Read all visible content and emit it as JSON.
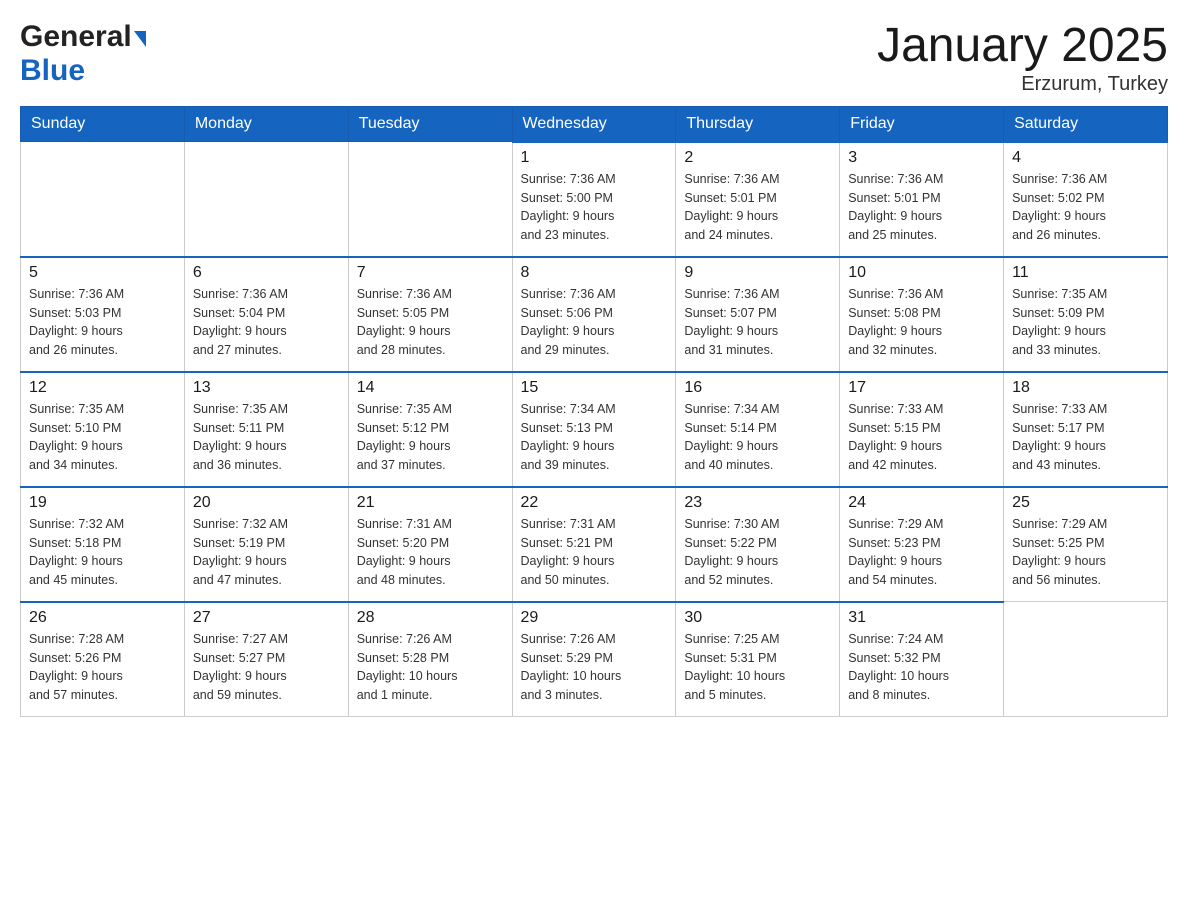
{
  "header": {
    "logo_general": "General",
    "logo_blue": "Blue",
    "month_title": "January 2025",
    "location": "Erzurum, Turkey"
  },
  "days_of_week": [
    "Sunday",
    "Monday",
    "Tuesday",
    "Wednesday",
    "Thursday",
    "Friday",
    "Saturday"
  ],
  "weeks": [
    [
      {
        "day": "",
        "info": ""
      },
      {
        "day": "",
        "info": ""
      },
      {
        "day": "",
        "info": ""
      },
      {
        "day": "1",
        "info": "Sunrise: 7:36 AM\nSunset: 5:00 PM\nDaylight: 9 hours\nand 23 minutes."
      },
      {
        "day": "2",
        "info": "Sunrise: 7:36 AM\nSunset: 5:01 PM\nDaylight: 9 hours\nand 24 minutes."
      },
      {
        "day": "3",
        "info": "Sunrise: 7:36 AM\nSunset: 5:01 PM\nDaylight: 9 hours\nand 25 minutes."
      },
      {
        "day": "4",
        "info": "Sunrise: 7:36 AM\nSunset: 5:02 PM\nDaylight: 9 hours\nand 26 minutes."
      }
    ],
    [
      {
        "day": "5",
        "info": "Sunrise: 7:36 AM\nSunset: 5:03 PM\nDaylight: 9 hours\nand 26 minutes."
      },
      {
        "day": "6",
        "info": "Sunrise: 7:36 AM\nSunset: 5:04 PM\nDaylight: 9 hours\nand 27 minutes."
      },
      {
        "day": "7",
        "info": "Sunrise: 7:36 AM\nSunset: 5:05 PM\nDaylight: 9 hours\nand 28 minutes."
      },
      {
        "day": "8",
        "info": "Sunrise: 7:36 AM\nSunset: 5:06 PM\nDaylight: 9 hours\nand 29 minutes."
      },
      {
        "day": "9",
        "info": "Sunrise: 7:36 AM\nSunset: 5:07 PM\nDaylight: 9 hours\nand 31 minutes."
      },
      {
        "day": "10",
        "info": "Sunrise: 7:36 AM\nSunset: 5:08 PM\nDaylight: 9 hours\nand 32 minutes."
      },
      {
        "day": "11",
        "info": "Sunrise: 7:35 AM\nSunset: 5:09 PM\nDaylight: 9 hours\nand 33 minutes."
      }
    ],
    [
      {
        "day": "12",
        "info": "Sunrise: 7:35 AM\nSunset: 5:10 PM\nDaylight: 9 hours\nand 34 minutes."
      },
      {
        "day": "13",
        "info": "Sunrise: 7:35 AM\nSunset: 5:11 PM\nDaylight: 9 hours\nand 36 minutes."
      },
      {
        "day": "14",
        "info": "Sunrise: 7:35 AM\nSunset: 5:12 PM\nDaylight: 9 hours\nand 37 minutes."
      },
      {
        "day": "15",
        "info": "Sunrise: 7:34 AM\nSunset: 5:13 PM\nDaylight: 9 hours\nand 39 minutes."
      },
      {
        "day": "16",
        "info": "Sunrise: 7:34 AM\nSunset: 5:14 PM\nDaylight: 9 hours\nand 40 minutes."
      },
      {
        "day": "17",
        "info": "Sunrise: 7:33 AM\nSunset: 5:15 PM\nDaylight: 9 hours\nand 42 minutes."
      },
      {
        "day": "18",
        "info": "Sunrise: 7:33 AM\nSunset: 5:17 PM\nDaylight: 9 hours\nand 43 minutes."
      }
    ],
    [
      {
        "day": "19",
        "info": "Sunrise: 7:32 AM\nSunset: 5:18 PM\nDaylight: 9 hours\nand 45 minutes."
      },
      {
        "day": "20",
        "info": "Sunrise: 7:32 AM\nSunset: 5:19 PM\nDaylight: 9 hours\nand 47 minutes."
      },
      {
        "day": "21",
        "info": "Sunrise: 7:31 AM\nSunset: 5:20 PM\nDaylight: 9 hours\nand 48 minutes."
      },
      {
        "day": "22",
        "info": "Sunrise: 7:31 AM\nSunset: 5:21 PM\nDaylight: 9 hours\nand 50 minutes."
      },
      {
        "day": "23",
        "info": "Sunrise: 7:30 AM\nSunset: 5:22 PM\nDaylight: 9 hours\nand 52 minutes."
      },
      {
        "day": "24",
        "info": "Sunrise: 7:29 AM\nSunset: 5:23 PM\nDaylight: 9 hours\nand 54 minutes."
      },
      {
        "day": "25",
        "info": "Sunrise: 7:29 AM\nSunset: 5:25 PM\nDaylight: 9 hours\nand 56 minutes."
      }
    ],
    [
      {
        "day": "26",
        "info": "Sunrise: 7:28 AM\nSunset: 5:26 PM\nDaylight: 9 hours\nand 57 minutes."
      },
      {
        "day": "27",
        "info": "Sunrise: 7:27 AM\nSunset: 5:27 PM\nDaylight: 9 hours\nand 59 minutes."
      },
      {
        "day": "28",
        "info": "Sunrise: 7:26 AM\nSunset: 5:28 PM\nDaylight: 10 hours\nand 1 minute."
      },
      {
        "day": "29",
        "info": "Sunrise: 7:26 AM\nSunset: 5:29 PM\nDaylight: 10 hours\nand 3 minutes."
      },
      {
        "day": "30",
        "info": "Sunrise: 7:25 AM\nSunset: 5:31 PM\nDaylight: 10 hours\nand 5 minutes."
      },
      {
        "day": "31",
        "info": "Sunrise: 7:24 AM\nSunset: 5:32 PM\nDaylight: 10 hours\nand 8 minutes."
      },
      {
        "day": "",
        "info": ""
      }
    ]
  ]
}
